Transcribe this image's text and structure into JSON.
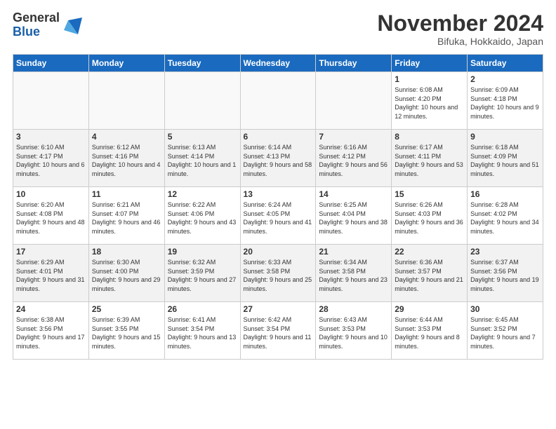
{
  "header": {
    "logo_general": "General",
    "logo_blue": "Blue",
    "title": "November 2024",
    "location": "Bifuka, Hokkaido, Japan"
  },
  "days_of_week": [
    "Sunday",
    "Monday",
    "Tuesday",
    "Wednesday",
    "Thursday",
    "Friday",
    "Saturday"
  ],
  "weeks": [
    [
      {
        "day": "",
        "info": ""
      },
      {
        "day": "",
        "info": ""
      },
      {
        "day": "",
        "info": ""
      },
      {
        "day": "",
        "info": ""
      },
      {
        "day": "",
        "info": ""
      },
      {
        "day": "1",
        "info": "Sunrise: 6:08 AM\nSunset: 4:20 PM\nDaylight: 10 hours and 12 minutes."
      },
      {
        "day": "2",
        "info": "Sunrise: 6:09 AM\nSunset: 4:18 PM\nDaylight: 10 hours and 9 minutes."
      }
    ],
    [
      {
        "day": "3",
        "info": "Sunrise: 6:10 AM\nSunset: 4:17 PM\nDaylight: 10 hours and 6 minutes."
      },
      {
        "day": "4",
        "info": "Sunrise: 6:12 AM\nSunset: 4:16 PM\nDaylight: 10 hours and 4 minutes."
      },
      {
        "day": "5",
        "info": "Sunrise: 6:13 AM\nSunset: 4:14 PM\nDaylight: 10 hours and 1 minute."
      },
      {
        "day": "6",
        "info": "Sunrise: 6:14 AM\nSunset: 4:13 PM\nDaylight: 9 hours and 58 minutes."
      },
      {
        "day": "7",
        "info": "Sunrise: 6:16 AM\nSunset: 4:12 PM\nDaylight: 9 hours and 56 minutes."
      },
      {
        "day": "8",
        "info": "Sunrise: 6:17 AM\nSunset: 4:11 PM\nDaylight: 9 hours and 53 minutes."
      },
      {
        "day": "9",
        "info": "Sunrise: 6:18 AM\nSunset: 4:09 PM\nDaylight: 9 hours and 51 minutes."
      }
    ],
    [
      {
        "day": "10",
        "info": "Sunrise: 6:20 AM\nSunset: 4:08 PM\nDaylight: 9 hours and 48 minutes."
      },
      {
        "day": "11",
        "info": "Sunrise: 6:21 AM\nSunset: 4:07 PM\nDaylight: 9 hours and 46 minutes."
      },
      {
        "day": "12",
        "info": "Sunrise: 6:22 AM\nSunset: 4:06 PM\nDaylight: 9 hours and 43 minutes."
      },
      {
        "day": "13",
        "info": "Sunrise: 6:24 AM\nSunset: 4:05 PM\nDaylight: 9 hours and 41 minutes."
      },
      {
        "day": "14",
        "info": "Sunrise: 6:25 AM\nSunset: 4:04 PM\nDaylight: 9 hours and 38 minutes."
      },
      {
        "day": "15",
        "info": "Sunrise: 6:26 AM\nSunset: 4:03 PM\nDaylight: 9 hours and 36 minutes."
      },
      {
        "day": "16",
        "info": "Sunrise: 6:28 AM\nSunset: 4:02 PM\nDaylight: 9 hours and 34 minutes."
      }
    ],
    [
      {
        "day": "17",
        "info": "Sunrise: 6:29 AM\nSunset: 4:01 PM\nDaylight: 9 hours and 31 minutes."
      },
      {
        "day": "18",
        "info": "Sunrise: 6:30 AM\nSunset: 4:00 PM\nDaylight: 9 hours and 29 minutes."
      },
      {
        "day": "19",
        "info": "Sunrise: 6:32 AM\nSunset: 3:59 PM\nDaylight: 9 hours and 27 minutes."
      },
      {
        "day": "20",
        "info": "Sunrise: 6:33 AM\nSunset: 3:58 PM\nDaylight: 9 hours and 25 minutes."
      },
      {
        "day": "21",
        "info": "Sunrise: 6:34 AM\nSunset: 3:58 PM\nDaylight: 9 hours and 23 minutes."
      },
      {
        "day": "22",
        "info": "Sunrise: 6:36 AM\nSunset: 3:57 PM\nDaylight: 9 hours and 21 minutes."
      },
      {
        "day": "23",
        "info": "Sunrise: 6:37 AM\nSunset: 3:56 PM\nDaylight: 9 hours and 19 minutes."
      }
    ],
    [
      {
        "day": "24",
        "info": "Sunrise: 6:38 AM\nSunset: 3:56 PM\nDaylight: 9 hours and 17 minutes."
      },
      {
        "day": "25",
        "info": "Sunrise: 6:39 AM\nSunset: 3:55 PM\nDaylight: 9 hours and 15 minutes."
      },
      {
        "day": "26",
        "info": "Sunrise: 6:41 AM\nSunset: 3:54 PM\nDaylight: 9 hours and 13 minutes."
      },
      {
        "day": "27",
        "info": "Sunrise: 6:42 AM\nSunset: 3:54 PM\nDaylight: 9 hours and 11 minutes."
      },
      {
        "day": "28",
        "info": "Sunrise: 6:43 AM\nSunset: 3:53 PM\nDaylight: 9 hours and 10 minutes."
      },
      {
        "day": "29",
        "info": "Sunrise: 6:44 AM\nSunset: 3:53 PM\nDaylight: 9 hours and 8 minutes."
      },
      {
        "day": "30",
        "info": "Sunrise: 6:45 AM\nSunset: 3:52 PM\nDaylight: 9 hours and 7 minutes."
      }
    ]
  ]
}
